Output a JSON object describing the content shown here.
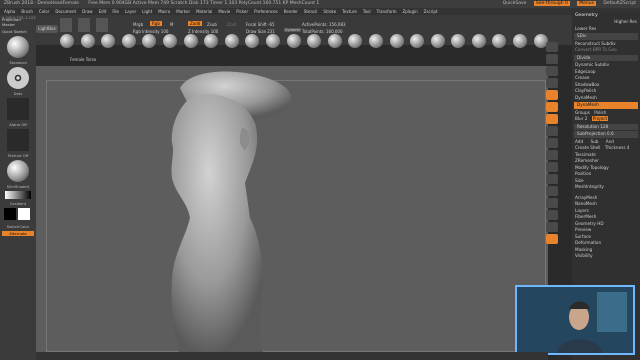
{
  "title": "ZBrush 2018 - DemoHeadFemale",
  "title_stats": "Free Mem 0.904GB  Active Mem 749  Scratch Disk 173  Timer 1.103  PolyCount 160.751 KP  MeshCount 1",
  "title_right": {
    "quicksave": "QuickSave",
    "seethrough": "See-through 0",
    "menus": "Menus",
    "script": "DefaultZScript"
  },
  "menus": [
    "Alpha",
    "Brush",
    "Color",
    "Document",
    "Draw",
    "Edit",
    "File",
    "Layer",
    "Light",
    "Macro",
    "Marker",
    "Material",
    "Movie",
    "Picker",
    "Preferences",
    "Render",
    "Stencil",
    "Stroke",
    "Texture",
    "Tool",
    "Transform",
    "Zplugin",
    "Zscript"
  ],
  "shelf": {
    "lightbox": "LightBox",
    "mrgb": "Mrgb",
    "rgb": "Rgb",
    "m": "M",
    "rgb_intensity": "Rgb Intensity 100",
    "zadd": "Zadd",
    "zsub": "Zsub",
    "zcut": "Zcut",
    "z_intensity": "Z Intensity 100",
    "focal_shift": "Focal Shift -65",
    "draw_size": "Draw Size 231",
    "dynamic": "Dynamic",
    "active_points": "ActivePoints: 156,083",
    "total_points": "TotalPoints: 160,000",
    "brush_label": "Female Torso"
  },
  "left_panel": {
    "projection": "Projection Master",
    "quicksketch": "Quick Sketch",
    "brush": "Standard",
    "stroke": "Dots",
    "alpha": "Alpha Off",
    "texture": "Texture Off",
    "material": "SkinShade4",
    "gradient": "Gradient",
    "switchcolor": "SwitchColor",
    "alternate": "Alternate",
    "coords": "0.345,0.743,-1.123"
  },
  "right_panel": {
    "geometry": "Geometry",
    "higher_res": "Higher Res",
    "lower_res": "Lower Res",
    "sdiv": "SDiv",
    "reconstruct": "Reconstruct Subdiv",
    "convert_bpr": "Convert BPR To Geo",
    "divide": "Divide",
    "dynamic_subdiv": "Dynamic Subdiv",
    "edgeloop": "EdgeLoop",
    "crease": "Crease",
    "shadowbox": "ShadowBox",
    "clay_polish": "ClayPolish",
    "dynamesh": "DynaMesh",
    "dynamesh_btn": "DynaMesh",
    "group": "Groups",
    "polish": "Polish",
    "blur": "Blur 2",
    "project": "Project",
    "resolution": "Resolution 128",
    "subprojection": "SubProjection 0.6",
    "add": "Add",
    "sub": "Sub",
    "and": "And",
    "create_shell": "Create Shell",
    "thickness": "Thickness 4",
    "tessimate": "Tessimate",
    "zremesher": "ZRemesher",
    "modify_topology": "Modify Topology",
    "position": "Position",
    "size": "Size",
    "meshintegrity": "MeshIntegrity",
    "subtools": [
      "ArrayMesh",
      "NanoMesh",
      "Layers",
      "FiberMesh",
      "Geometry HD",
      "Preview",
      "Surface",
      "Deformation",
      "Masking",
      "Visibility"
    ]
  },
  "colors": {
    "accent": "#e8822b",
    "canvas": "#5d5d5d",
    "panel": "#3b3b3b"
  }
}
